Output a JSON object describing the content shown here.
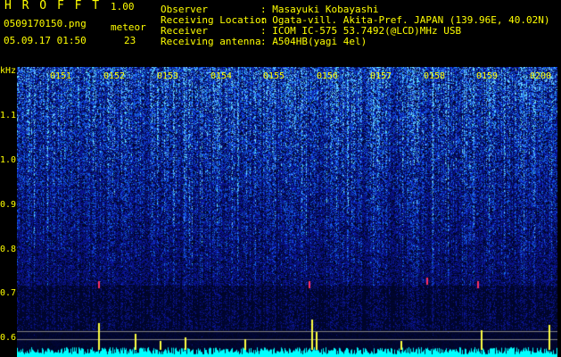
{
  "header": {
    "app_title": "H R O F F T",
    "version": "1.00",
    "filename": "0509170150.png",
    "meteor_label": "meteor",
    "date_time": "05.09.17 01:50",
    "meteor_count": "23"
  },
  "info": [
    {
      "key": "Observer",
      "value": ": Masayuki Kobayashi"
    },
    {
      "key": "Receiving Location",
      "value": ": Ogata-vill. Akita-Pref. JAPAN (139.96E, 40.02N)"
    },
    {
      "key": "Receiver",
      "value": ": ICOM IC-575 53.7492(@LCD)MHz USB"
    },
    {
      "key": "Receiving antenna",
      "value": ": A504HB(yagi 4el)"
    }
  ],
  "axis": {
    "unit_label": "kHz",
    "freq_ticks": [
      "1.1",
      "1.0",
      "0.9",
      "0.8",
      "0.7",
      "0.6"
    ],
    "time_ticks": [
      "0151",
      "0152",
      "0153",
      "0154",
      "0155",
      "0156",
      "0157",
      "0158",
      "0159",
      "0200"
    ]
  },
  "colors": {
    "text": "#ffff00",
    "background": "#000000",
    "noise_dark": "#000a3a",
    "noise_mid": "#1030c0",
    "noise_bright": "#40c0ff",
    "baseline": "#00ffff",
    "meteor_spike": "#ffff40",
    "meteor_echo": "#ff3060"
  }
}
